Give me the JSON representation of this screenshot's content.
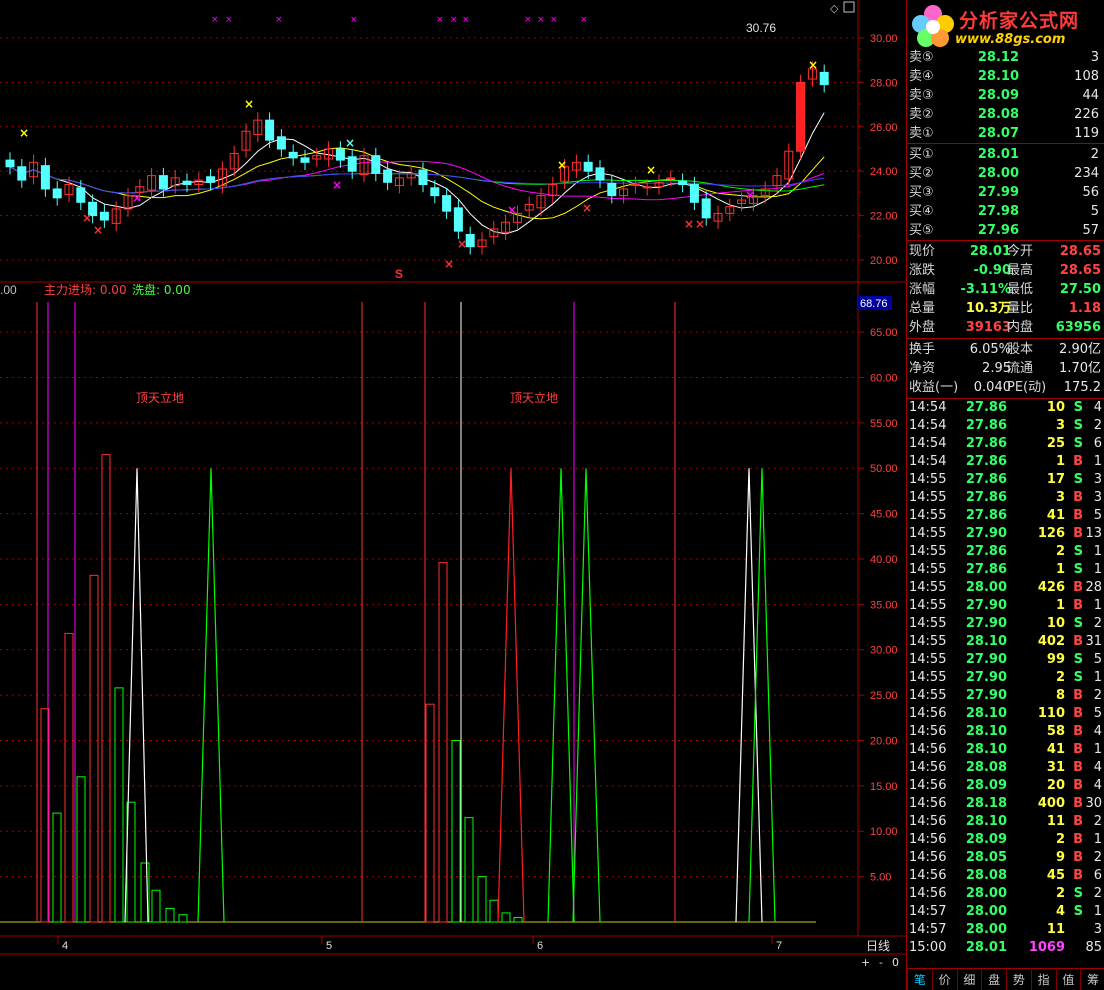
{
  "logo": {
    "name": "分析家公式网",
    "url": "www.88gs.com"
  },
  "main": {
    "y_ticks": [
      "30.00",
      "28.00",
      "26.00",
      "24.00",
      "22.00",
      "20.00"
    ],
    "peak_label": "30.76",
    "s_marker": "S"
  },
  "sub": {
    "legend_prefix": ".00",
    "legend_main": "主力进场: 0.00",
    "legend_wash": "洗盘: 0.00",
    "current_value": "68.76",
    "y_ticks": [
      "65.00",
      "60.00",
      "55.00",
      "50.00",
      "45.00",
      "40.00",
      "35.00",
      "30.00",
      "25.00",
      "20.00",
      "15.00",
      "10.00",
      "5.00"
    ],
    "annotations": [
      "顶天立地",
      "顶天立地"
    ]
  },
  "x_ticks": [
    "4",
    "5",
    "6",
    "7"
  ],
  "period_button": "日线",
  "zoom": {
    "plus": "+",
    "minus": "-",
    "circle": "0"
  },
  "sell_orders": [
    {
      "label": "卖⑤",
      "price": "28.12",
      "vol": "3"
    },
    {
      "label": "卖④",
      "price": "28.10",
      "vol": "108"
    },
    {
      "label": "卖③",
      "price": "28.09",
      "vol": "44"
    },
    {
      "label": "卖②",
      "price": "28.08",
      "vol": "226"
    },
    {
      "label": "卖①",
      "price": "28.07",
      "vol": "119"
    }
  ],
  "buy_orders": [
    {
      "label": "买①",
      "price": "28.01",
      "vol": "2"
    },
    {
      "label": "买②",
      "price": "28.00",
      "vol": "234"
    },
    {
      "label": "买③",
      "price": "27.99",
      "vol": "56"
    },
    {
      "label": "买④",
      "price": "27.98",
      "vol": "5"
    },
    {
      "label": "买⑤",
      "price": "27.96",
      "vol": "57"
    }
  ],
  "quote": [
    {
      "l1": "现价",
      "v1": "28.01",
      "c1": "g",
      "l2": "今开",
      "v2": "28.65",
      "c2": "r"
    },
    {
      "l1": "涨跌",
      "v1": "-0.90",
      "c1": "g",
      "l2": "最高",
      "v2": "28.65",
      "c2": "r"
    },
    {
      "l1": "涨幅",
      "v1": "-3.11%",
      "c1": "g",
      "l2": "最低",
      "v2": "27.50",
      "c2": "g"
    },
    {
      "l1": "总量",
      "v1": "10.3万",
      "c1": "y",
      "l2": "量比",
      "v2": "1.18",
      "c2": "r"
    },
    {
      "l1": "外盘",
      "v1": "39163",
      "c1": "r",
      "l2": "内盘",
      "v2": "63956",
      "c2": "g"
    }
  ],
  "fundamentals": [
    {
      "l1": "换手",
      "v1": "6.05%",
      "l2": "股本",
      "v2": "2.90亿"
    },
    {
      "l1": "净资",
      "v1": "2.95",
      "l2": "流通",
      "v2": "1.70亿"
    },
    {
      "l1": "收益(一)",
      "v1": "0.040",
      "l2": "PE(动)",
      "v2": "175.2"
    }
  ],
  "ticks": [
    {
      "t": "14:54",
      "p": "27.86",
      "v": "10",
      "s": "S",
      "n": "4"
    },
    {
      "t": "14:54",
      "p": "27.86",
      "v": "3",
      "s": "S",
      "n": "2"
    },
    {
      "t": "14:54",
      "p": "27.86",
      "v": "25",
      "s": "S",
      "n": "6"
    },
    {
      "t": "14:54",
      "p": "27.86",
      "v": "1",
      "s": "B",
      "n": "1"
    },
    {
      "t": "14:55",
      "p": "27.86",
      "v": "17",
      "s": "S",
      "n": "3"
    },
    {
      "t": "14:55",
      "p": "27.86",
      "v": "3",
      "s": "B",
      "n": "3"
    },
    {
      "t": "14:55",
      "p": "27.86",
      "v": "41",
      "s": "B",
      "n": "5"
    },
    {
      "t": "14:55",
      "p": "27.90",
      "v": "126",
      "s": "B",
      "n": "13"
    },
    {
      "t": "14:55",
      "p": "27.86",
      "v": "2",
      "s": "S",
      "n": "1"
    },
    {
      "t": "14:55",
      "p": "27.86",
      "v": "1",
      "s": "S",
      "n": "1"
    },
    {
      "t": "14:55",
      "p": "28.00",
      "v": "426",
      "s": "B",
      "n": "28"
    },
    {
      "t": "14:55",
      "p": "27.90",
      "v": "1",
      "s": "B",
      "n": "1"
    },
    {
      "t": "14:55",
      "p": "27.90",
      "v": "10",
      "s": "S",
      "n": "2"
    },
    {
      "t": "14:55",
      "p": "28.10",
      "v": "402",
      "s": "B",
      "n": "31"
    },
    {
      "t": "14:55",
      "p": "27.90",
      "v": "99",
      "s": "S",
      "n": "5"
    },
    {
      "t": "14:55",
      "p": "27.90",
      "v": "2",
      "s": "S",
      "n": "1"
    },
    {
      "t": "14:55",
      "p": "27.90",
      "v": "8",
      "s": "B",
      "n": "2"
    },
    {
      "t": "14:56",
      "p": "28.10",
      "v": "110",
      "s": "B",
      "n": "5"
    },
    {
      "t": "14:56",
      "p": "28.10",
      "v": "58",
      "s": "B",
      "n": "4"
    },
    {
      "t": "14:56",
      "p": "28.10",
      "v": "41",
      "s": "B",
      "n": "1"
    },
    {
      "t": "14:56",
      "p": "28.08",
      "v": "31",
      "s": "B",
      "n": "4"
    },
    {
      "t": "14:56",
      "p": "28.09",
      "v": "20",
      "s": "B",
      "n": "4"
    },
    {
      "t": "14:56",
      "p": "28.18",
      "v": "400",
      "s": "B",
      "n": "30"
    },
    {
      "t": "14:56",
      "p": "28.10",
      "v": "11",
      "s": "B",
      "n": "2"
    },
    {
      "t": "14:56",
      "p": "28.09",
      "v": "2",
      "s": "B",
      "n": "1"
    },
    {
      "t": "14:56",
      "p": "28.05",
      "v": "9",
      "s": "B",
      "n": "2"
    },
    {
      "t": "14:56",
      "p": "28.08",
      "v": "45",
      "s": "B",
      "n": "6"
    },
    {
      "t": "14:56",
      "p": "28.00",
      "v": "2",
      "s": "S",
      "n": "2"
    },
    {
      "t": "14:57",
      "p": "28.00",
      "v": "4",
      "s": "S",
      "n": "1"
    },
    {
      "t": "14:57",
      "p": "28.00",
      "v": "11",
      "s": "",
      "n": "3"
    },
    {
      "t": "15:00",
      "p": "28.01",
      "v": "1069",
      "s": "",
      "n": "85"
    }
  ],
  "tabs": [
    "笔",
    "价",
    "细",
    "盘",
    "势",
    "指",
    "值",
    "筹"
  ],
  "colors": {
    "grid_red": "#a00000",
    "up": "#ff3030",
    "down": "#54ffff",
    "ma_white": "#ffffff",
    "ma_yellow": "#ffff00",
    "ma_magenta": "#ff00ff",
    "ma_green": "#00ff00",
    "ma_blue": "#4040ff"
  }
}
